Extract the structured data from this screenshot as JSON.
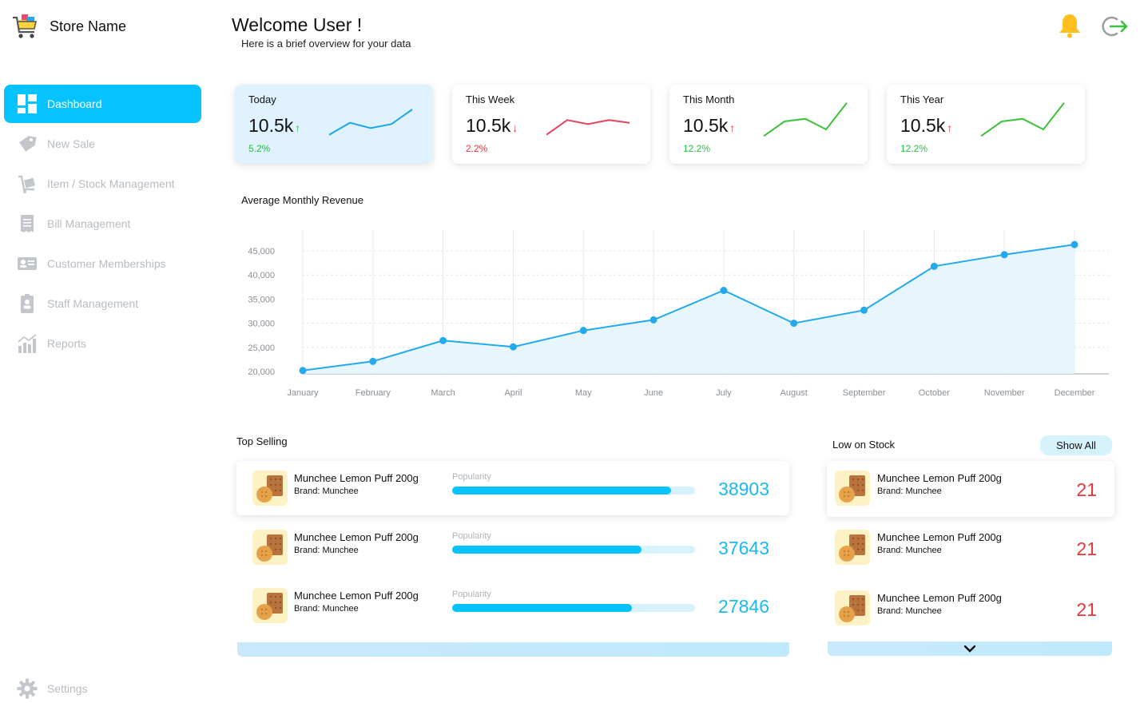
{
  "brand": {
    "name": "Store Name",
    "icon": "cart-icon"
  },
  "nav": {
    "items": [
      {
        "label": "Dashboard",
        "icon": "dashboard-icon",
        "active": true
      },
      {
        "label": "New Sale",
        "icon": "sale-tag-icon"
      },
      {
        "label": "Item / Stock Management",
        "icon": "trolley-icon"
      },
      {
        "label": "Bill Management",
        "icon": "receipt-icon"
      },
      {
        "label": "Customer Memberships",
        "icon": "id-card-icon"
      },
      {
        "label": "Staff Management",
        "icon": "badge-icon"
      },
      {
        "label": "Reports",
        "icon": "bar-chart-icon"
      }
    ],
    "settings_label": "Settings"
  },
  "header": {
    "title": "Welcome User !",
    "subtitle": "Here is a brief overview for your data"
  },
  "stats": [
    {
      "label": "Today",
      "value": "10.5k",
      "arrow": "↑",
      "pct": "5.2%",
      "trend": "up",
      "spark": [
        10,
        28,
        20,
        26,
        48
      ]
    },
    {
      "label": "This Week",
      "value": "10.5k",
      "arrow": "↓",
      "pct": "2.2%",
      "trend": "down",
      "spark": [
        10,
        32,
        26,
        32,
        28
      ]
    },
    {
      "label": "This Month",
      "value": "10.5k",
      "arrow": "↑",
      "pct": "12.2%",
      "trend": "up",
      "spark": [
        8,
        30,
        34,
        18,
        58
      ]
    },
    {
      "label": "This Year",
      "value": "10.5k",
      "arrow": "↑",
      "pct": "12.2%",
      "trend": "up",
      "spark": [
        8,
        30,
        34,
        18,
        58
      ]
    }
  ],
  "colors": {
    "accent": "#06c3ff",
    "up_arrow_today": "#2bbf46",
    "up": "#2bbf46",
    "down": "#e5373b",
    "spark_blue": "#1aa7e8",
    "spark_red": "#e5415c",
    "spark_green": "#3cc23a",
    "count_blue": "#1cb9f0"
  },
  "chart_data": {
    "type": "area",
    "title": "Average Monthly Revenue",
    "categories": [
      "January",
      "February",
      "March",
      "April",
      "May",
      "June",
      "July",
      "August",
      "September",
      "October",
      "November",
      "December"
    ],
    "values": [
      20200,
      22100,
      26400,
      25100,
      28500,
      30700,
      36800,
      30000,
      32700,
      41800,
      44200,
      46300
    ],
    "yticks": [
      "45,000",
      "40,000",
      "35,000",
      "30,000",
      "25,000",
      "20,000"
    ],
    "ylim": [
      20000,
      45000
    ],
    "grid": true
  },
  "top_selling": {
    "title": "Top Selling",
    "popularity_label": "Popularity",
    "items": [
      {
        "name": "Munchee Lemon Puff 200g",
        "brand": "Brand: Munchee",
        "popularity": 0.9,
        "count": "38903"
      },
      {
        "name": "Munchee Lemon Puff 200g",
        "brand": "Brand: Munchee",
        "popularity": 0.78,
        "count": "37643"
      },
      {
        "name": "Munchee Lemon Puff 200g",
        "brand": "Brand: Munchee",
        "popularity": 0.74,
        "count": "27846"
      }
    ]
  },
  "low_stock": {
    "title": "Low on Stock",
    "show_all": "Show All",
    "expand_icon": "chevron-down-icon",
    "items": [
      {
        "name": "Munchee Lemon Puff 200g",
        "brand": "Brand: Munchee",
        "count": "21"
      },
      {
        "name": "Munchee Lemon Puff 200g",
        "brand": "Brand: Munchee",
        "count": "21"
      },
      {
        "name": "Munchee Lemon Puff 200g",
        "brand": "Brand: Munchee",
        "count": "21"
      }
    ]
  }
}
